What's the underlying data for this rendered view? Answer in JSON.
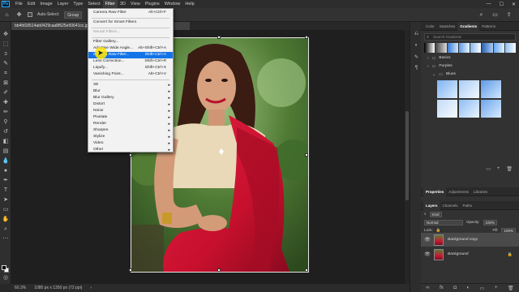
{
  "app": {
    "logo": "Ps"
  },
  "menubar": {
    "items": [
      "File",
      "Edit",
      "Image",
      "Layer",
      "Type",
      "Select",
      "Filter",
      "3D",
      "View",
      "Plugins",
      "Window",
      "Help"
    ],
    "active_index": 6
  },
  "options": {
    "auto_select_label": "Auto-Select:",
    "auto_select_value": "Group"
  },
  "document": {
    "tab_title": "bb4fd18514ab0429caa8f625e50641cc.jpg"
  },
  "filter_menu": {
    "items": [
      {
        "label": "Camera Raw Filter",
        "shortcut": "Alt+Ctrl+F"
      },
      {
        "label": "Convert for Smart Filters",
        "shortcut": ""
      },
      {
        "label": "Neural Filters...",
        "shortcut": "",
        "disabled": true
      },
      {
        "label": "Filter Gallery...",
        "shortcut": ""
      },
      {
        "label": "Adaptive Wide Angle...",
        "shortcut": "Alt+Shift+Ctrl+A"
      },
      {
        "label": "Camera Raw Filter...",
        "shortcut": "Shift+Ctrl+A",
        "highlighted": true
      },
      {
        "label": "Lens Correction...",
        "shortcut": "Shift+Ctrl+R"
      },
      {
        "label": "Liquify...",
        "shortcut": "Shift+Ctrl+X"
      },
      {
        "label": "Vanishing Point...",
        "shortcut": "Alt+Ctrl+V"
      },
      {
        "label": "3D",
        "submenu": true
      },
      {
        "label": "Blur",
        "submenu": true
      },
      {
        "label": "Blur Gallery",
        "submenu": true
      },
      {
        "label": "Distort",
        "submenu": true
      },
      {
        "label": "Noise",
        "submenu": true
      },
      {
        "label": "Pixelate",
        "submenu": true
      },
      {
        "label": "Render",
        "submenu": true
      },
      {
        "label": "Sharpen",
        "submenu": true
      },
      {
        "label": "Stylize",
        "submenu": true
      },
      {
        "label": "Video",
        "submenu": true
      },
      {
        "label": "Other",
        "submenu": true
      }
    ]
  },
  "status": {
    "zoom": "60.3%",
    "doc_info": "1080 px x 1350 px (72 ppi)"
  },
  "gradients_panel": {
    "tabs": [
      "Color",
      "Swatches",
      "Gradients",
      "Patterns"
    ],
    "active_tab": 2,
    "search_placeholder": "Search Gradients",
    "folders": [
      "Basics",
      "Purples",
      "Blues"
    ]
  },
  "layers_panel": {
    "top_tabs": [
      "Properties",
      "Adjustments",
      "Libraries"
    ],
    "tabs": [
      "Layers",
      "Channels",
      "Paths"
    ],
    "kind_label": "Kind",
    "blend_mode": "Normal",
    "opacity_label": "Opacity:",
    "opacity_value": "100%",
    "lock_label": "Lock:",
    "fill_label": "Fill:",
    "fill_value": "100%",
    "layers": [
      {
        "name": "Background copy",
        "active": true
      },
      {
        "name": "Background",
        "active": false
      }
    ]
  },
  "colors": {
    "highlight": "#1473e6",
    "saree": "#c8102e",
    "accent_ps": "#31a8ff"
  }
}
